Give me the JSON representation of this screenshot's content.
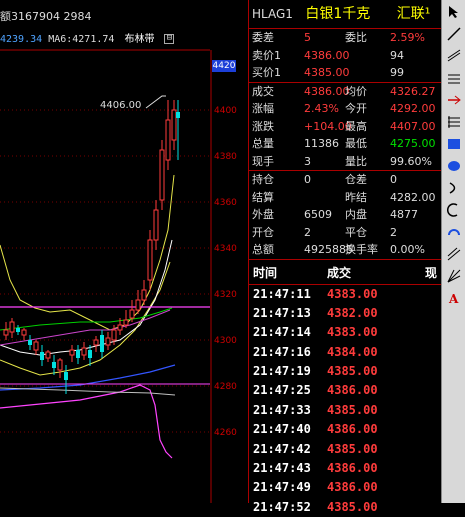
{
  "chart": {
    "header": "额3167904 2984",
    "ma_first": "4239.34",
    "ma_label": "MA6:4271.74",
    "indicator": "布林带",
    "collapse_glyph": "⊟",
    "price_tag": "4420",
    "peak_label": "4406.00",
    "y_axis": [
      "4400",
      "4380",
      "4360",
      "4340",
      "4320",
      "4300",
      "4280",
      "4260",
      "4240"
    ]
  },
  "quote": {
    "code": "HLAG1",
    "name": "白银1千克",
    "company": "汇联¹",
    "rows": [
      {
        "l1": "委差",
        "v1": "5",
        "c1": "red",
        "l2": "委比",
        "v2": "2.59%",
        "c2": "red"
      },
      {
        "l1": "卖价1",
        "v1": "4386.00",
        "c1": "red",
        "l2": "",
        "v2": "94",
        "c2": "wht"
      },
      {
        "l1": "买价1",
        "v1": "4385.00",
        "c1": "red",
        "l2": "",
        "v2": "99",
        "c2": "wht"
      },
      {
        "l1": "成交",
        "v1": "4386.00",
        "c1": "red",
        "l2": "均价",
        "v2": "4326.27",
        "c2": "red"
      },
      {
        "l1": "涨幅",
        "v1": "2.43%",
        "c1": "red",
        "l2": "今开",
        "v2": "4292.00",
        "c2": "red"
      },
      {
        "l1": "涨跌",
        "v1": "+104.00",
        "c1": "red",
        "l2": "最高",
        "v2": "4407.00",
        "c2": "red"
      },
      {
        "l1": "总量",
        "v1": "11386",
        "c1": "wht",
        "l2": "最低",
        "v2": "4275.00",
        "c2": "grn"
      },
      {
        "l1": "现手",
        "v1": "3",
        "c1": "wht",
        "l2": "量比",
        "v2": "99.60%",
        "c2": "wht"
      },
      {
        "l1": "持仓",
        "v1": "0",
        "c1": "wht",
        "l2": "仓差",
        "v2": "0",
        "c2": "wht"
      },
      {
        "l1": "结算",
        "v1": "",
        "c1": "wht",
        "l2": "昨结",
        "v2": "4282.00",
        "c2": "wht"
      },
      {
        "l1": "外盘",
        "v1": "6509",
        "c1": "wht",
        "l2": "内盘",
        "v2": "4877",
        "c2": "wht"
      },
      {
        "l1": "开仓",
        "v1": "2",
        "c1": "wht",
        "l2": "平仓",
        "v2": "2",
        "c2": "wht"
      },
      {
        "l1": "总额",
        "v1": "4925885",
        "c1": "wht",
        "l2": "换手率",
        "v2": "0.00%",
        "c2": "wht"
      }
    ],
    "tick_header": {
      "time": "时间",
      "trade": "成交",
      "cur": "现"
    },
    "ticks": [
      {
        "time": "21:47:11",
        "price": "4383.00",
        "c": "red"
      },
      {
        "time": "21:47:13",
        "price": "4382.00",
        "c": "red"
      },
      {
        "time": "21:47:14",
        "price": "4383.00",
        "c": "red"
      },
      {
        "time": "21:47:16",
        "price": "4384.00",
        "c": "red"
      },
      {
        "time": "21:47:19",
        "price": "4385.00",
        "c": "red"
      },
      {
        "time": "21:47:25",
        "price": "4386.00",
        "c": "red"
      },
      {
        "time": "21:47:33",
        "price": "4385.00",
        "c": "red"
      },
      {
        "time": "21:47:40",
        "price": "4386.00",
        "c": "red"
      },
      {
        "time": "21:47:42",
        "price": "4385.00",
        "c": "red"
      },
      {
        "time": "21:47:43",
        "price": "4386.00",
        "c": "red"
      },
      {
        "time": "21:47:49",
        "price": "4386.00",
        "c": "red"
      },
      {
        "time": "21:47:52",
        "price": "4385.00",
        "c": "red"
      }
    ]
  }
}
